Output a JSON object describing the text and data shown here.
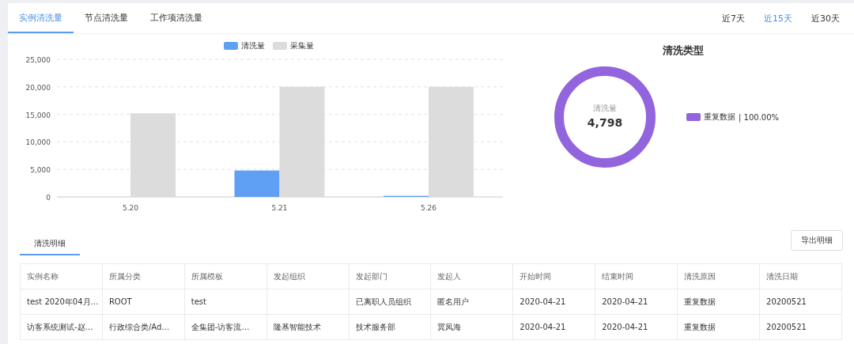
{
  "tabs": [
    {
      "label": "实例清洗量",
      "selected": true
    },
    {
      "label": "节点清洗量",
      "selected": false
    },
    {
      "label": "工作项清洗量",
      "selected": false
    }
  ],
  "ranges": [
    {
      "label": "近7天",
      "selected": false
    },
    {
      "label": "近15天",
      "selected": true
    },
    {
      "label": "近30天",
      "selected": false
    }
  ],
  "bar_chart": {
    "chart_data": {
      "type": "bar",
      "categories": [
        "5.20",
        "5.21",
        "5.26"
      ],
      "series": [
        {
          "name": "清洗量",
          "color": "#5fa0f5",
          "values": [
            0,
            4800,
            200
          ]
        },
        {
          "name": "采集量",
          "color": "#dcdcdc",
          "values": [
            15200,
            20000,
            20000
          ]
        }
      ],
      "ylim": [
        0,
        25000
      ],
      "yticks": [
        {
          "value": 0,
          "label": "0"
        },
        {
          "value": 5000,
          "label": "5,000"
        },
        {
          "value": 10000,
          "label": "10,000"
        },
        {
          "value": 15000,
          "label": "15,000"
        },
        {
          "value": 20000,
          "label": "20,000"
        },
        {
          "value": 25000,
          "label": "25,000"
        }
      ],
      "grid": true,
      "legend": true
    }
  },
  "donut": {
    "title": "清洗类型",
    "center_label": "清洗量",
    "center_value": "4,798",
    "legend": [
      {
        "label": "重复数据",
        "share": "| 100.00%",
        "color": "#9264dd"
      }
    ]
  },
  "detail_tab": {
    "label": "清洗明细",
    "selected": true
  },
  "export_button": "导出明细",
  "table": {
    "columns": [
      "实例名称",
      "所属分类",
      "所属模板",
      "发起组织",
      "发起部门",
      "发起人",
      "开始时间",
      "结束时间",
      "清洗原因",
      "清洗日期"
    ],
    "rows": [
      [
        "test 2020年04月…",
        "ROOT",
        "test",
        "",
        "已离职人员组织",
        "匿名用户",
        "2020-04-21",
        "2020-04-21",
        "重复数据",
        "20200521"
      ],
      [
        "访客系统测试-赵…",
        "行政综合类/Ad…",
        "全集团-访客流…",
        "隆基智能技术",
        "技术服务部",
        "冀凤海",
        "2020-04-21",
        "2020-04-21",
        "重复数据",
        "20200521"
      ]
    ]
  }
}
